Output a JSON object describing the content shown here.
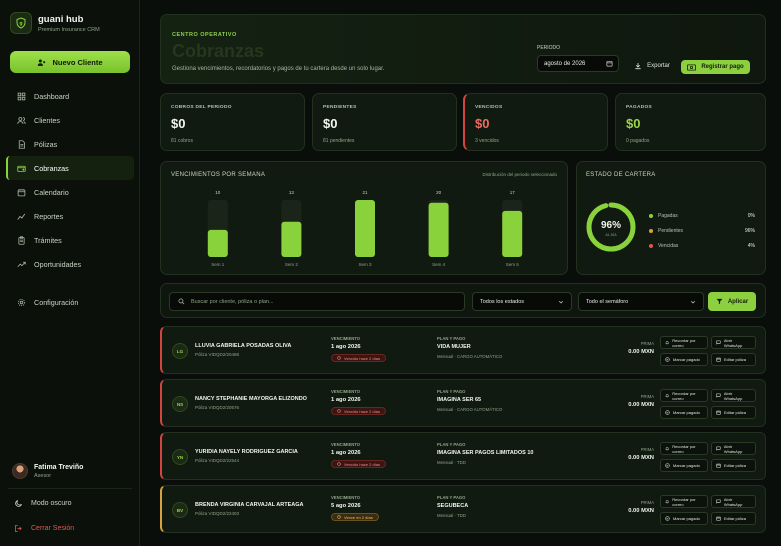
{
  "app": {
    "name": "guani hub",
    "subtitle": "Premium Insurance CRM",
    "logo_icon": "shield-icon"
  },
  "sidebar": {
    "new_client_label": "Nuevo Cliente",
    "items": [
      {
        "label": "Dashboard",
        "icon": "grid-icon",
        "active": false
      },
      {
        "label": "Clientes",
        "icon": "users-icon",
        "active": false
      },
      {
        "label": "Pólizas",
        "icon": "document-icon",
        "active": false
      },
      {
        "label": "Cobranzas",
        "icon": "wallet-icon",
        "active": true
      },
      {
        "label": "Calendario",
        "icon": "calendar-icon",
        "active": false
      },
      {
        "label": "Reportes",
        "icon": "chart-line-icon",
        "active": false
      },
      {
        "label": "Trámites",
        "icon": "clipboard-icon",
        "active": false
      },
      {
        "label": "Oportunidades",
        "icon": "trend-up-icon",
        "active": false
      }
    ],
    "settings_label": "Configuración",
    "user": {
      "name": "Fatima Treviño",
      "role": "Asesor"
    },
    "dark_mode_label": "Modo oscuro",
    "logout_label": "Cerrar Sesión"
  },
  "hero": {
    "kicker": "CENTRO OPERATIVO",
    "title": "Cobranzas",
    "description": "Gestiona vencimientos, recordatorios y pagos de tu cartera desde un solo lugar.",
    "period_label": "PERIODO",
    "period_value": "agosto de 2026",
    "export_label": "Exportar",
    "register_label": "Registrar pago"
  },
  "stats": [
    {
      "label": "COBROS DEL PERIODO",
      "value": "$0",
      "sub": "81 cobros",
      "tone": "neutral"
    },
    {
      "label": "PENDIENTES",
      "value": "$0",
      "sub": "81 pendientes",
      "tone": "neutral"
    },
    {
      "label": "VENCIDOS",
      "value": "$0",
      "sub": "3 vencidos",
      "tone": "red"
    },
    {
      "label": "PAGADOS",
      "value": "$0",
      "sub": "0 pagados",
      "tone": "green"
    }
  ],
  "chart_data": {
    "type": "bar",
    "title": "VENCIMIENTOS POR SEMANA",
    "subtitle": "Distribución del periodo seleccionado",
    "categories": [
      "Sem 1",
      "Sem 2",
      "Sem 3",
      "Sem 4",
      "Sem 5"
    ],
    "values": [
      10,
      13,
      21,
      20,
      17
    ],
    "ylim": [
      0,
      21
    ],
    "grid": false,
    "bar_color": "#8ad23c",
    "track_color": "#1a2418"
  },
  "portfolio": {
    "title": "ESTADO DE CARTERA",
    "percent": "96%",
    "percent_value": 96,
    "center_sub": "AL DÍA",
    "legend": [
      {
        "label": "Pagadas",
        "value": "0%",
        "color": "#8ad23c"
      },
      {
        "label": "Pendientes",
        "value": "96%",
        "color": "#d6a43a"
      },
      {
        "label": "Vencidas",
        "value": "4%",
        "color": "#e2564d"
      }
    ]
  },
  "filters": {
    "search_placeholder": "Buscar por cliente, póliza o plan...",
    "status_value": "Todos los estados",
    "semaphore_value": "Todo el semáforo",
    "apply_label": "Aplicar"
  },
  "rows": [
    {
      "initials": "LG",
      "name": "LLUVIA GABRIELA POSADAS OLIVA",
      "policy": "Póliza VIDQD2/20488",
      "due_label": "VENCIMIENTO",
      "due_date": "1 ago 2026",
      "badge": "Vencido hace 2 días",
      "tone": "red",
      "plan_label": "PLAN Y PAGO",
      "plan": "VIDA MUJER",
      "method": "Mensual · CARGO AUTOMÁTICO",
      "prima_label": "PRIMA",
      "prima": "0.00 MXN",
      "actions": [
        "Recordar por correo",
        "Abrir WhatsApp",
        "Marcar pagado",
        "Editar póliza"
      ]
    },
    {
      "initials": "NS",
      "name": "NANCY STEPHANIE MAYORGA ELIZONDO",
      "policy": "Póliza VIDQD2/20576",
      "due_label": "VENCIMIENTO",
      "due_date": "1 ago 2026",
      "badge": "Vencido hace 2 días",
      "tone": "red",
      "plan_label": "PLAN Y PAGO",
      "plan": "IMAGINA SER 65",
      "method": "Mensual · CARGO AUTOMÁTICO",
      "prima_label": "PRIMA",
      "prima": "0.00 MXN",
      "actions": [
        "Recordar por correo",
        "Abrir WhatsApp",
        "Marcar pagado",
        "Editar póliza"
      ]
    },
    {
      "initials": "YN",
      "name": "YURIDIA NAYELY RODRIGUEZ GARCIA",
      "policy": "Póliza VIDQD2/22544",
      "due_label": "VENCIMIENTO",
      "due_date": "1 ago 2026",
      "badge": "Vencido hace 2 días",
      "tone": "red",
      "plan_label": "PLAN Y PAGO",
      "plan": "IMAGINA SER PAGOS LIMITADOS 10",
      "method": "Mensual · TDD",
      "prima_label": "PRIMA",
      "prima": "0.00 MXN",
      "actions": [
        "Recordar por correo",
        "Abrir WhatsApp",
        "Marcar pagado",
        "Editar póliza"
      ]
    },
    {
      "initials": "BV",
      "name": "BRENDA VIRGINIA CARVAJAL ARTEAGA",
      "policy": "Póliza VIDQD2/22403",
      "due_label": "VENCIMIENTO",
      "due_date": "5 ago 2026",
      "badge": "Vence en 2 días",
      "tone": "amber",
      "plan_label": "PLAN Y PAGO",
      "plan": "SEGUBECA",
      "method": "Mensual · TDD",
      "prima_label": "PRIMA",
      "prima": "0.00 MXN",
      "actions": [
        "Recordar por correo",
        "Abrir WhatsApp",
        "Marcar pagado",
        "Editar póliza"
      ]
    }
  ]
}
